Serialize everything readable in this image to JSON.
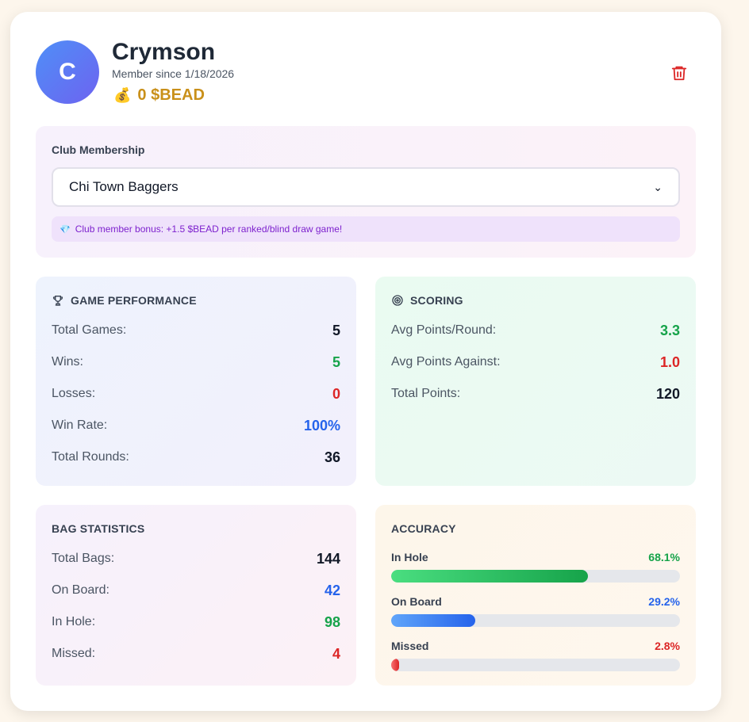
{
  "profile": {
    "avatar_letter": "C",
    "name": "Crymson",
    "member_since": "Member since 1/18/2026",
    "balance_icon": "money-bag-icon",
    "balance": "0 $BEAD",
    "delete_icon": "trash-icon"
  },
  "club": {
    "label": "Club Membership",
    "selected": "Chi Town Baggers",
    "bonus_text": "Club member bonus: +1.5 $BEAD per ranked/blind draw game!",
    "bonus_icon": "gem-icon"
  },
  "game_performance": {
    "title": "GAME PERFORMANCE",
    "icon": "trophy-icon",
    "rows": [
      {
        "label": "Total Games:",
        "value": "5"
      },
      {
        "label": "Wins:",
        "value": "5"
      },
      {
        "label": "Losses:",
        "value": "0"
      },
      {
        "label": "Win Rate:",
        "value": "100%"
      },
      {
        "label": "Total Rounds:",
        "value": "36"
      }
    ]
  },
  "scoring": {
    "title": "SCORING",
    "icon": "target-icon",
    "rows": [
      {
        "label": "Avg Points/Round:",
        "value": "3.3"
      },
      {
        "label": "Avg Points Against:",
        "value": "1.0"
      },
      {
        "label": "Total Points:",
        "value": "120"
      }
    ]
  },
  "bag_statistics": {
    "title": "BAG STATISTICS",
    "rows": [
      {
        "label": "Total Bags:",
        "value": "144"
      },
      {
        "label": "On Board:",
        "value": "42"
      },
      {
        "label": "In Hole:",
        "value": "98"
      },
      {
        "label": "Missed:",
        "value": "4"
      }
    ]
  },
  "accuracy": {
    "title": "ACCURACY",
    "rows": [
      {
        "label": "In Hole",
        "pct": "68.1%",
        "fraction": 0.681
      },
      {
        "label": "On Board",
        "pct": "29.2%",
        "fraction": 0.292
      },
      {
        "label": "Missed",
        "pct": "2.8%",
        "fraction": 0.028
      }
    ]
  },
  "colors": {
    "accent_gold": "#c9901a",
    "positive": "#16a34a",
    "negative": "#dc2626",
    "info": "#2563eb"
  }
}
